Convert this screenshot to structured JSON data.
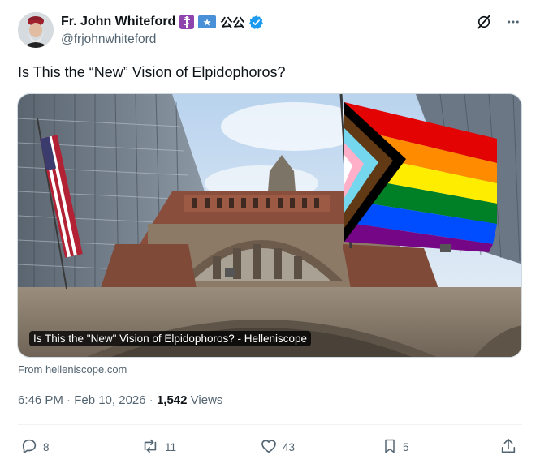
{
  "author": {
    "display_name": "Fr. John Whiteford",
    "handle": "@frjohnwhiteford",
    "extra_symbols": "公公"
  },
  "tweet": {
    "text": "Is This the “New” Vision of Elpidophoros?"
  },
  "card": {
    "caption": "Is This the \"New\" Vision of Elpidophoros? - Helleniscope",
    "source": "From helleniscope.com"
  },
  "meta": {
    "timestamp": "6:46 PM · Feb 10, 2026",
    "separator": "·",
    "views_count": "1,542",
    "views_label": "Views"
  },
  "actions": {
    "replies": "8",
    "reposts": "11",
    "likes": "43",
    "bookmarks": "5"
  },
  "colors": {
    "verified": "#1d9bf0",
    "orthodox_badge": "#8e44ad",
    "flag_badge": "#4a90d9",
    "muted": "#536471"
  },
  "icons": [
    "orthodox-cross-icon",
    "flag-icon",
    "verified-icon",
    "grok-icon",
    "more-icon",
    "reply-icon",
    "repost-icon",
    "like-icon",
    "bookmark-icon",
    "share-icon"
  ]
}
